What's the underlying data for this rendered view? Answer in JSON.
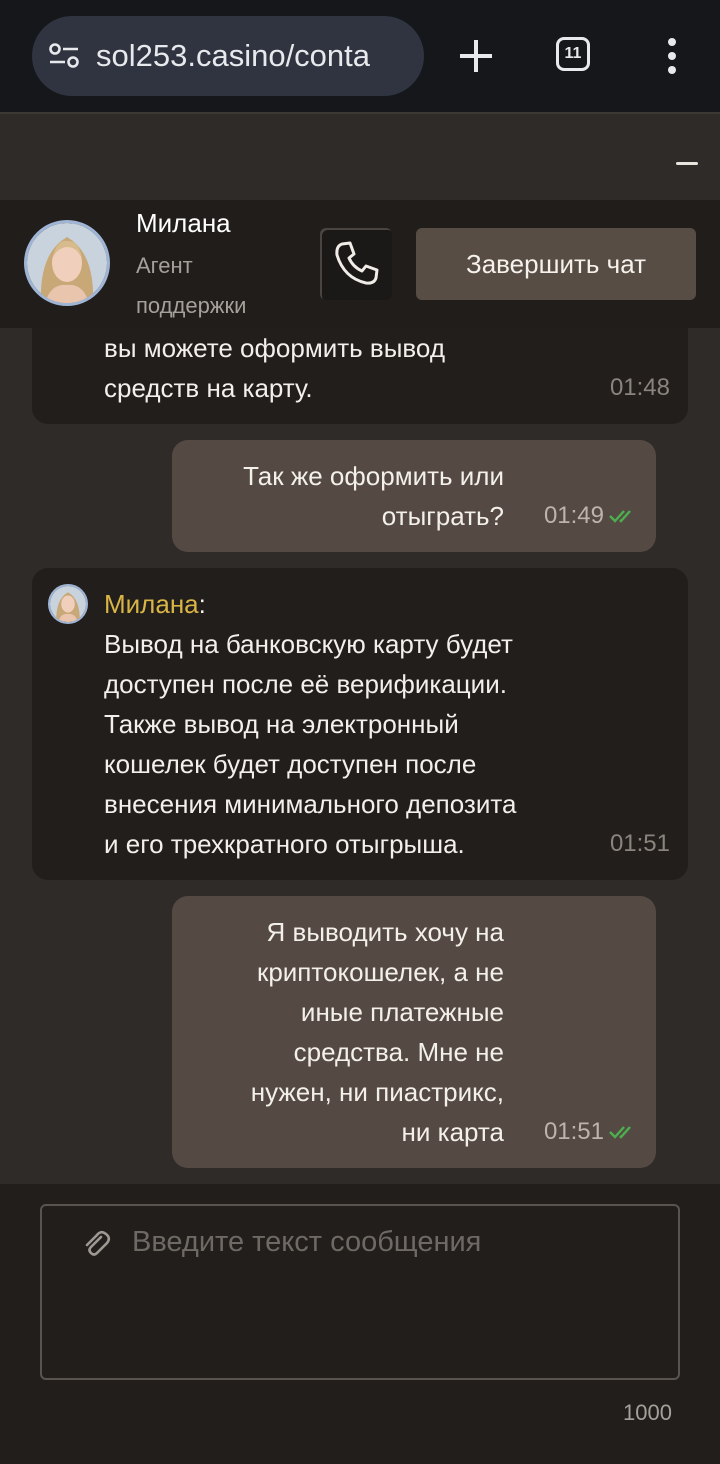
{
  "browser": {
    "url": "sol253.casino/conta",
    "tab_count": "11"
  },
  "agent": {
    "name": "Милана",
    "role": "Агент поддержки",
    "end_chat_label": "Завершить чат"
  },
  "messages": [
    {
      "direction": "in",
      "text": "вы можете оформить вывод\nсредств на карту.",
      "time": "01:48"
    },
    {
      "direction": "out",
      "text": "Так же оформить или\nотыграть?",
      "time": "01:49"
    },
    {
      "direction": "in",
      "sender": "Милана",
      "text": "Вывод на банковскую карту будет\nдоступен после её верификации.\nТакже вывод на электронный\nкошелек будет доступен после\nвнесения минимального депозита\nи его трехкратного отыгрыша.",
      "time": "01:51"
    },
    {
      "direction": "out",
      "text": "Я выводить хочу на\nкриптокошелек, а не\nиные платежные\nсредства. Мне не\nнужен, ни пиастрикс,\nни карта",
      "time": "01:51"
    }
  ],
  "composer": {
    "placeholder": "Введите текст сообщения",
    "char_limit": "1000"
  },
  "colors": {
    "accent_name": "#d9b545",
    "read_check": "#4caf50",
    "outgoing_bubble": "#544a43",
    "incoming_bubble": "#211e1c"
  }
}
